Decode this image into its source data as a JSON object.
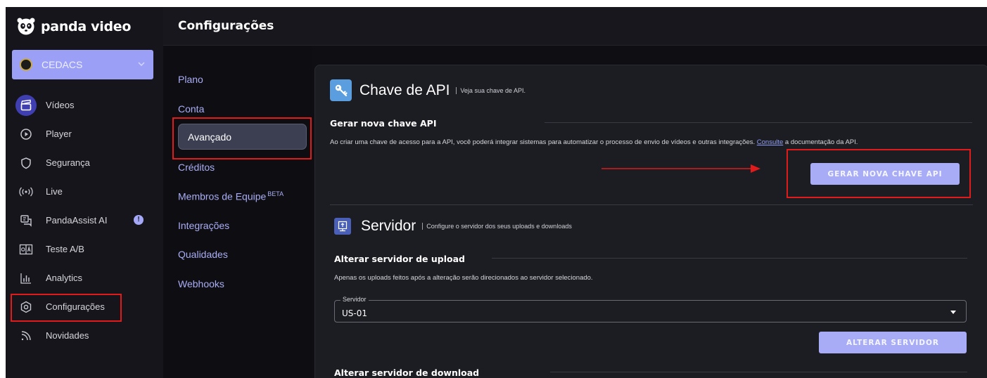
{
  "brand": {
    "name": "panda video",
    "logo_icon": "panda-face-icon"
  },
  "header": {
    "title": "Configurações"
  },
  "org": {
    "name": "CEDACS"
  },
  "nav": {
    "items": [
      {
        "label": "Vídeos",
        "icon": "clapperboard-icon"
      },
      {
        "label": "Player",
        "icon": "play-circle-icon"
      },
      {
        "label": "Segurança",
        "icon": "shield-icon"
      },
      {
        "label": "Live",
        "icon": "broadcast-icon"
      },
      {
        "label": "PandaAssist AI",
        "icon": "chat-assistant-icon",
        "badge": "!"
      },
      {
        "label": "Teste A/B",
        "icon": "ab-test-icon"
      },
      {
        "label": "Analytics",
        "icon": "bar-chart-icon"
      },
      {
        "label": "Configurações",
        "icon": "settings-hexagon-icon"
      },
      {
        "label": "Novidades",
        "icon": "rss-icon"
      }
    ]
  },
  "settings_menu": {
    "items": [
      {
        "label": "Plano"
      },
      {
        "label": "Conta"
      },
      {
        "label": "Avançado"
      },
      {
        "label": "Créditos"
      },
      {
        "label": "Membros de Equipe",
        "badge": "BETA"
      },
      {
        "label": "Integrações"
      },
      {
        "label": "Qualidades"
      },
      {
        "label": "Webhooks"
      }
    ]
  },
  "api": {
    "title": "Chave de API",
    "subtitle": "Veja sua chave de API.",
    "section_title": "Gerar nova chave API",
    "description_before": "Ao criar uma chave de acesso para a API, você poderá integrar sistemas para automatizar o processo de envio de vídeos e outras integrações. ",
    "description_link": "Consulte",
    "description_after": " a documentação da API.",
    "button": "GERAR NOVA CHAVE API"
  },
  "server": {
    "title": "Servidor",
    "subtitle": "Configure o servidor dos seus uploads e downloads",
    "upload_title": "Alterar servidor de upload",
    "upload_description": "Apenas os uploads feitos após a alteração serão direcionados ao servidor selecionado.",
    "select_label": "Servidor",
    "select_value": "US-01",
    "button": "ALTERAR SERVIDOR",
    "download_title": "Alterar servidor de download"
  },
  "colors": {
    "accent": "#a8acf7",
    "active_nav": "#3f3fb2",
    "highlight": "#e01b1b"
  }
}
